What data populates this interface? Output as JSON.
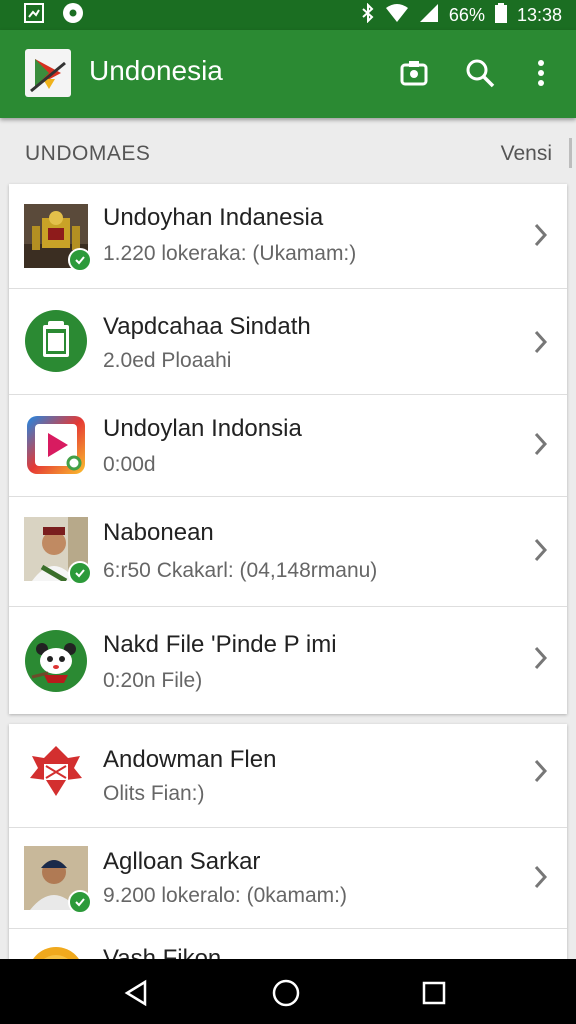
{
  "status_bar": {
    "time": "13:38",
    "battery": "66%"
  },
  "app_bar": {
    "title": "Undonesia",
    "actions": [
      "camera-icon",
      "search-icon",
      "more-vert-icon"
    ]
  },
  "section": {
    "title": "UNDOMAES",
    "right_label": "Vensi"
  },
  "list_items": [
    {
      "title": "Undoyhan Indanesia",
      "subtitle": "1.220 lokeraka: (Ukamam:)",
      "icon": "emblem-thumbnail",
      "verified": true
    },
    {
      "title": "Vapdcahaa Sindath",
      "subtitle": "2.0ed Ploaahi",
      "icon": "clipboard-icon",
      "verified": false
    },
    {
      "title": "Undoylan Indonsia",
      "subtitle": "0:00d",
      "icon": "video-app-icon",
      "verified": false
    },
    {
      "title": "Nabonean",
      "subtitle": "6:r50 Ckakarl: (04,148rmanu)",
      "icon": "person-thumbnail",
      "verified": true
    },
    {
      "title": "Nakd File 'Pinde P imi",
      "subtitle": "0:20n File)",
      "icon": "panda-icon",
      "verified": false
    },
    {
      "title": "Andowman Flen",
      "subtitle": "Olits Fian:)",
      "icon": "eagle-logo",
      "verified": false
    },
    {
      "title": "Aglloan Sarkar",
      "subtitle": "9.200 lokeralo: (0kamam:)",
      "icon": "person-thumbnail",
      "verified": true
    },
    {
      "title": "Vash Fikon",
      "subtitle": "",
      "icon": "coin-icon",
      "verified": false
    }
  ],
  "colors": {
    "app_bar": "#2b8a33",
    "status_bar": "#1b6e22",
    "verified_badge": "#2c9a3a"
  },
  "nav_bar": [
    "back-icon",
    "home-icon",
    "recents-icon"
  ]
}
